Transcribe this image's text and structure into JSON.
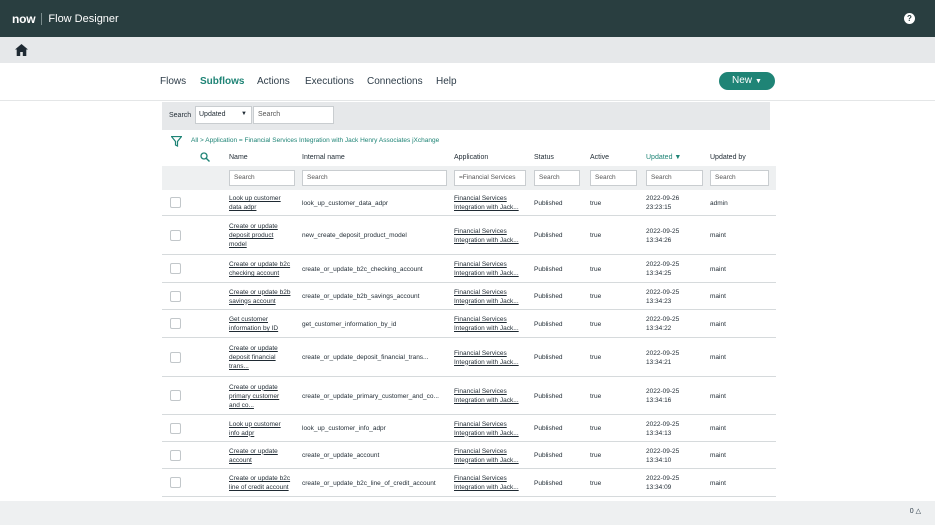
{
  "header": {
    "logo": "now",
    "title": "Flow Designer",
    "help": "?"
  },
  "nav": {
    "tabs": [
      "Flows",
      "Subflows",
      "Actions",
      "Executions",
      "Connections",
      "Help"
    ],
    "active": "Subflows",
    "new_label": "New"
  },
  "search": {
    "label": "Search",
    "select_value": "Updated",
    "placeholder": "Search"
  },
  "breadcrumb": "All > Application = Financial Services Integration with Jack Henry Associates jXchange",
  "columns": [
    "Name",
    "Internal name",
    "Application",
    "Status",
    "Active",
    "Updated ▼",
    "Updated by"
  ],
  "filters": {
    "name": "Search",
    "internal": "Search",
    "application": "=Financial Services",
    "status": "Search",
    "active": "Search",
    "updated": "Search",
    "updated_by": "Search"
  },
  "rows": [
    {
      "name": [
        "Look up customer",
        "data adpr"
      ],
      "internal": "look_up_customer_data_adpr",
      "app": [
        "Financial Services",
        "Integration with Jack..."
      ],
      "status": "Published",
      "active": "true",
      "updated": [
        "2022-09-26",
        "23:23:15"
      ],
      "by": "admin"
    },
    {
      "name": [
        "Create or update",
        "deposit product",
        "model"
      ],
      "internal": "new_create_deposit_product_model",
      "app": [
        "Financial Services",
        "Integration with Jack..."
      ],
      "status": "Published",
      "active": "true",
      "updated": [
        "2022-09-25",
        "13:34:26"
      ],
      "by": "maint"
    },
    {
      "name": [
        "Create or update b2c",
        "checking account"
      ],
      "internal": "create_or_update_b2c_checking_account",
      "app": [
        "Financial Services",
        "Integration with Jack..."
      ],
      "status": "Published",
      "active": "true",
      "updated": [
        "2022-09-25",
        "13:34:25"
      ],
      "by": "maint"
    },
    {
      "name": [
        "Create or update b2b",
        "savings account"
      ],
      "internal": "create_or_update_b2b_savings_account",
      "app": [
        "Financial Services",
        "Integration with Jack..."
      ],
      "status": "Published",
      "active": "true",
      "updated": [
        "2022-09-25",
        "13:34:23"
      ],
      "by": "maint"
    },
    {
      "name": [
        "Get customer",
        "information by ID"
      ],
      "internal": "get_customer_information_by_id",
      "app": [
        "Financial Services",
        "Integration with Jack..."
      ],
      "status": "Published",
      "active": "true",
      "updated": [
        "2022-09-25",
        "13:34:22"
      ],
      "by": "maint"
    },
    {
      "name": [
        "Create or update",
        "deposit financial",
        "trans..."
      ],
      "internal": "create_or_update_deposit_financial_trans...",
      "app": [
        "Financial Services",
        "Integration with Jack..."
      ],
      "status": "Published",
      "active": "true",
      "updated": [
        "2022-09-25",
        "13:34:21"
      ],
      "by": "maint"
    },
    {
      "name": [
        "Create or update",
        "primary customer",
        "and co..."
      ],
      "internal": "create_or_update_primary_customer_and_co...",
      "app": [
        "Financial Services",
        "Integration with Jack..."
      ],
      "status": "Published",
      "active": "true",
      "updated": [
        "2022-09-25",
        "13:34:16"
      ],
      "by": "maint"
    },
    {
      "name": [
        "Look up customer",
        "info adpr"
      ],
      "internal": "look_up_customer_info_adpr",
      "app": [
        "Financial Services",
        "Integration with Jack..."
      ],
      "status": "Published",
      "active": "true",
      "updated": [
        "2022-09-25",
        "13:34:13"
      ],
      "by": "maint"
    },
    {
      "name": [
        "Create or update",
        "account"
      ],
      "internal": "create_or_update_account",
      "app": [
        "Financial Services",
        "Integration with Jack..."
      ],
      "status": "Published",
      "active": "true",
      "updated": [
        "2022-09-25",
        "13:34:10"
      ],
      "by": "maint"
    },
    {
      "name": [
        "Create or update b2c",
        "line of credit account"
      ],
      "internal": "create_or_update_b2c_line_of_credit_account",
      "app": [
        "Financial Services",
        "Integration with Jack..."
      ],
      "status": "Published",
      "active": "true",
      "updated": [
        "2022-09-25",
        "13:34:09"
      ],
      "by": "maint"
    }
  ],
  "footer": {
    "text": "0"
  }
}
